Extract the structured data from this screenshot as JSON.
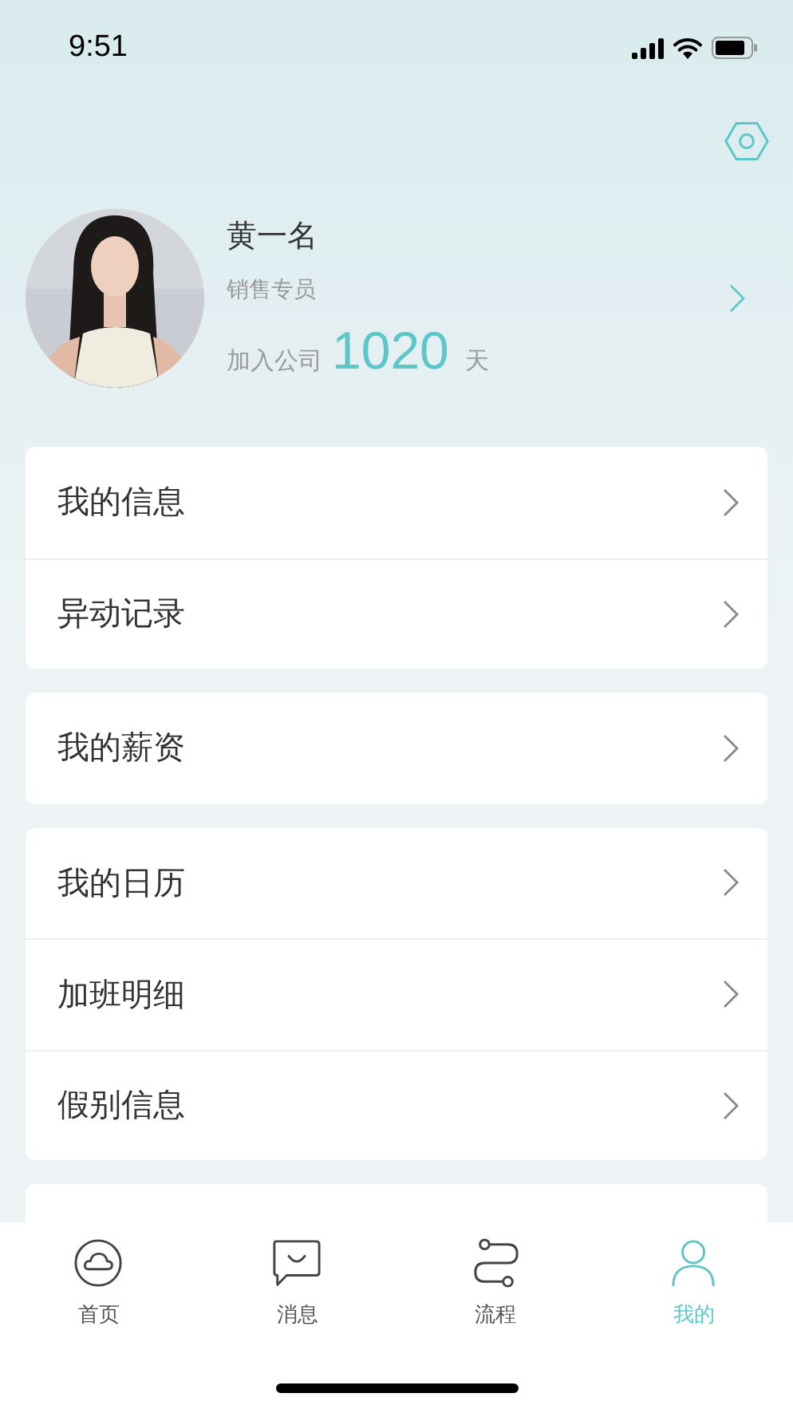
{
  "status_bar": {
    "time": "9:51"
  },
  "profile": {
    "name": "黄一名",
    "role": "销售专员",
    "tenure_label": "加入公司",
    "tenure_days": "1020",
    "tenure_unit": "天"
  },
  "menu_groups": [
    {
      "items": [
        {
          "label": "我的信息"
        },
        {
          "label": "异动记录"
        }
      ]
    },
    {
      "items": [
        {
          "label": "我的薪资"
        }
      ]
    },
    {
      "items": [
        {
          "label": "我的日历"
        },
        {
          "label": "加班明细"
        },
        {
          "label": "假别信息"
        }
      ]
    }
  ],
  "tab_bar": [
    {
      "label": "首页",
      "selected": false
    },
    {
      "label": "消息",
      "selected": false
    },
    {
      "label": "流程",
      "selected": false
    },
    {
      "label": "我的",
      "selected": true
    }
  ]
}
